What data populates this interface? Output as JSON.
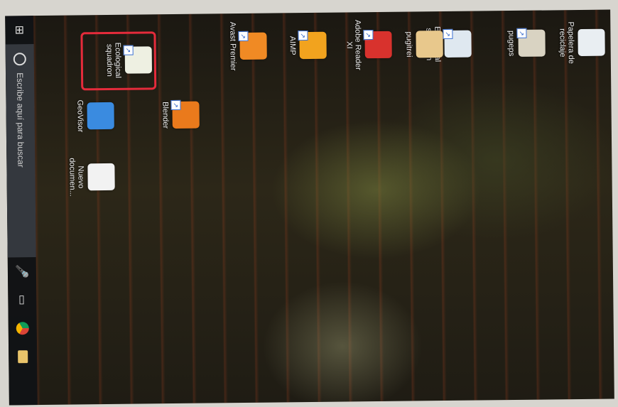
{
  "desktop": {
    "icons": [
      {
        "label": "Papelera de reciclaje",
        "color": "#e9eef2",
        "icon": "recycle-bin-icon"
      },
      {
        "label": "Ecological squadron",
        "color": "#dfe8f0",
        "icon": "document-icon"
      },
      {
        "label": "Ecological squadron",
        "color": "#eef0e2",
        "icon": "document-icon",
        "selected": true
      },
      {
        "label": "pugeps",
        "color": "#d9d3c2",
        "icon": "app-icon"
      },
      {
        "label": "pugitrei",
        "color": "#e8c88c",
        "icon": "folder-icon"
      },
      {
        "label": "Adobe Reader XI",
        "color": "#d8322d",
        "icon": "pdf-icon"
      },
      {
        "label": "AIMP",
        "color": "#f2a31e",
        "icon": "aimp-icon"
      },
      {
        "label": "Avast Premier",
        "color": "#f08a24",
        "icon": "avast-icon"
      },
      {
        "label": "Blender",
        "color": "#ea7a1c",
        "icon": "blender-icon"
      },
      {
        "label": "GeoVisor",
        "color": "#3a8be0",
        "icon": "geovisor-icon"
      },
      {
        "label": "Nuevo documen...",
        "color": "#f2f2f2",
        "icon": "document-icon"
      }
    ],
    "highlight_label": "Ecological squadron"
  },
  "taskbar": {
    "search_placeholder": "Escribe aquí para buscar"
  }
}
